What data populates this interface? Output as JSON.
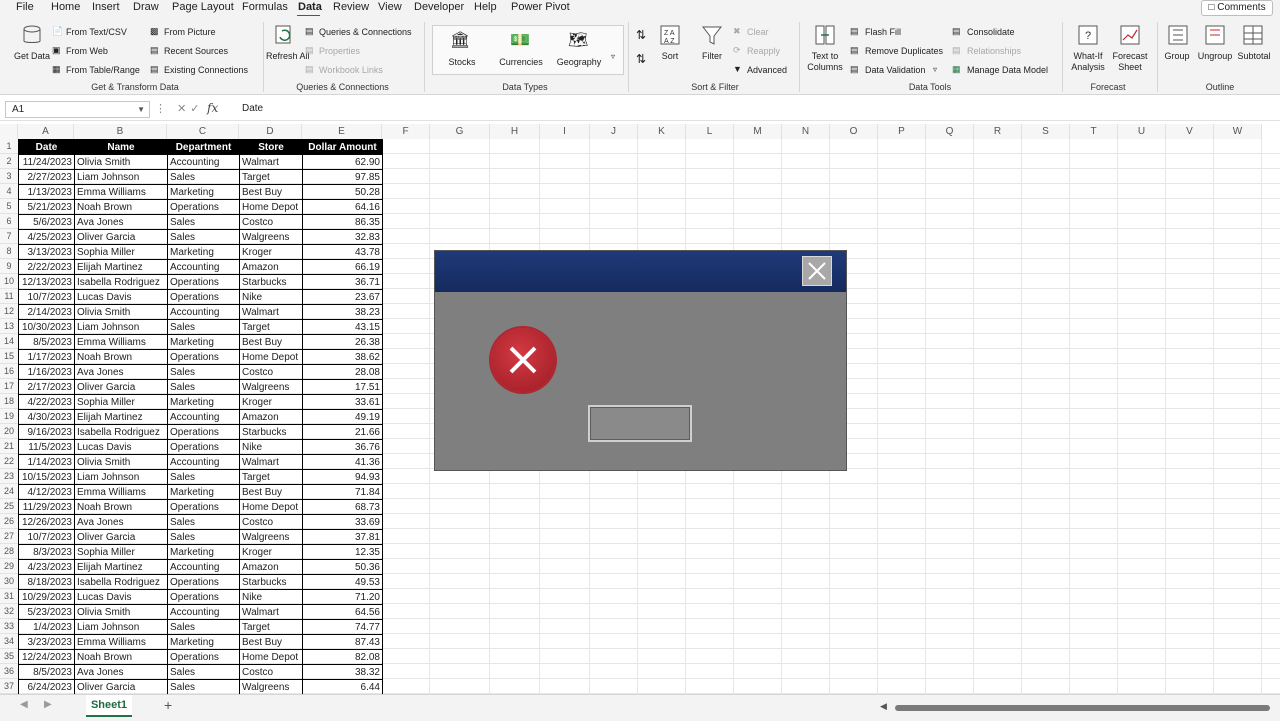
{
  "menu_tabs": [
    "File",
    "Home",
    "Insert",
    "Draw",
    "Page Layout",
    "Formulas",
    "Data",
    "Review",
    "View",
    "Developer",
    "Help",
    "Power Pivot"
  ],
  "active_tab": "Data",
  "comments_label": "Comments",
  "ribbon": {
    "get_data": "Get Data",
    "from_text_csv": "From Text/CSV",
    "from_web": "From Web",
    "from_table_range": "From Table/Range",
    "from_picture": "From Picture",
    "recent_sources": "Recent Sources",
    "existing_connections": "Existing Connections",
    "refresh_all": "Refresh All",
    "queries_connections": "Queries & Connections",
    "properties": "Properties",
    "workbook_links": "Workbook Links",
    "stocks": "Stocks",
    "currencies": "Currencies",
    "geography": "Geography",
    "sort": "Sort",
    "filter": "Filter",
    "clear": "Clear",
    "reapply": "Reapply",
    "advanced": "Advanced",
    "text_to_columns": "Text to Columns",
    "flash_fill": "Flash Fill",
    "remove_duplicates": "Remove Duplicates",
    "data_validation": "Data Validation",
    "consolidate": "Consolidate",
    "relationships": "Relationships",
    "manage_data_model": "Manage Data Model",
    "what_if": "What-If Analysis",
    "forecast_sheet": "Forecast Sheet",
    "group": "Group",
    "ungroup": "Ungroup",
    "subtotal": "Subtotal",
    "groups": {
      "get_transform": "Get & Transform Data",
      "queries": "Queries & Connections",
      "data_types": "Data Types",
      "sort_filter": "Sort & Filter",
      "data_tools": "Data Tools",
      "forecast": "Forecast",
      "outline": "Outline"
    }
  },
  "formula_bar": {
    "cell_ref": "A1",
    "value": "Date"
  },
  "columns": [
    "A",
    "B",
    "C",
    "D",
    "E",
    "F",
    "G",
    "H",
    "I",
    "J",
    "K",
    "L",
    "M",
    "N",
    "O",
    "P",
    "Q",
    "R",
    "S",
    "T",
    "U",
    "V",
    "W"
  ],
  "rows": [
    "1",
    "2",
    "3",
    "4",
    "5",
    "6",
    "7",
    "8",
    "9",
    "10",
    "11",
    "12",
    "13",
    "14",
    "15",
    "16",
    "17",
    "18",
    "19",
    "20",
    "21",
    "22",
    "23",
    "24",
    "25",
    "26",
    "27",
    "28",
    "29",
    "30",
    "31",
    "32",
    "33",
    "34",
    "35",
    "36",
    "37"
  ],
  "table": {
    "headers": [
      "Date",
      "Name",
      "Department",
      "Store",
      "Dollar Amount"
    ],
    "rows": [
      [
        "11/24/2023",
        "Olivia Smith",
        "Accounting",
        "Walmart",
        "62.90"
      ],
      [
        "2/27/2023",
        "Liam Johnson",
        "Sales",
        "Target",
        "97.85"
      ],
      [
        "1/13/2023",
        "Emma Williams",
        "Marketing",
        "Best Buy",
        "50.28"
      ],
      [
        "5/21/2023",
        "Noah Brown",
        "Operations",
        "Home Depot",
        "64.16"
      ],
      [
        "5/6/2023",
        "Ava Jones",
        "Sales",
        "Costco",
        "86.35"
      ],
      [
        "4/25/2023",
        "Oliver Garcia",
        "Sales",
        "Walgreens",
        "32.83"
      ],
      [
        "3/13/2023",
        "Sophia Miller",
        "Marketing",
        "Kroger",
        "43.78"
      ],
      [
        "2/22/2023",
        "Elijah Martinez",
        "Accounting",
        "Amazon",
        "66.19"
      ],
      [
        "12/13/2023",
        "Isabella Rodriguez",
        "Operations",
        "Starbucks",
        "36.71"
      ],
      [
        "10/7/2023",
        "Lucas Davis",
        "Operations",
        "Nike",
        "23.67"
      ],
      [
        "2/14/2023",
        "Olivia Smith",
        "Accounting",
        "Walmart",
        "38.23"
      ],
      [
        "10/30/2023",
        "Liam Johnson",
        "Sales",
        "Target",
        "43.15"
      ],
      [
        "8/5/2023",
        "Emma Williams",
        "Marketing",
        "Best Buy",
        "26.38"
      ],
      [
        "1/17/2023",
        "Noah Brown",
        "Operations",
        "Home Depot",
        "38.62"
      ],
      [
        "1/16/2023",
        "Ava Jones",
        "Sales",
        "Costco",
        "28.08"
      ],
      [
        "2/17/2023",
        "Oliver Garcia",
        "Sales",
        "Walgreens",
        "17.51"
      ],
      [
        "4/22/2023",
        "Sophia Miller",
        "Marketing",
        "Kroger",
        "33.61"
      ],
      [
        "4/30/2023",
        "Elijah Martinez",
        "Accounting",
        "Amazon",
        "49.19"
      ],
      [
        "9/16/2023",
        "Isabella Rodriguez",
        "Operations",
        "Starbucks",
        "21.66"
      ],
      [
        "11/5/2023",
        "Lucas Davis",
        "Operations",
        "Nike",
        "36.76"
      ],
      [
        "1/14/2023",
        "Olivia Smith",
        "Accounting",
        "Walmart",
        "41.36"
      ],
      [
        "10/15/2023",
        "Liam Johnson",
        "Sales",
        "Target",
        "94.93"
      ],
      [
        "4/12/2023",
        "Emma Williams",
        "Marketing",
        "Best Buy",
        "71.84"
      ],
      [
        "11/29/2023",
        "Noah Brown",
        "Operations",
        "Home Depot",
        "68.73"
      ],
      [
        "12/26/2023",
        "Ava Jones",
        "Sales",
        "Costco",
        "33.69"
      ],
      [
        "10/7/2023",
        "Oliver Garcia",
        "Sales",
        "Walgreens",
        "37.81"
      ],
      [
        "8/3/2023",
        "Sophia Miller",
        "Marketing",
        "Kroger",
        "12.35"
      ],
      [
        "4/23/2023",
        "Elijah Martinez",
        "Accounting",
        "Amazon",
        "50.36"
      ],
      [
        "8/18/2023",
        "Isabella Rodriguez",
        "Operations",
        "Starbucks",
        "49.53"
      ],
      [
        "10/29/2023",
        "Lucas Davis",
        "Operations",
        "Nike",
        "71.20"
      ],
      [
        "5/23/2023",
        "Olivia Smith",
        "Accounting",
        "Walmart",
        "64.56"
      ],
      [
        "1/4/2023",
        "Liam Johnson",
        "Sales",
        "Target",
        "74.77"
      ],
      [
        "3/23/2023",
        "Emma Williams",
        "Marketing",
        "Best Buy",
        "87.43"
      ],
      [
        "12/24/2023",
        "Noah Brown",
        "Operations",
        "Home Depot",
        "82.08"
      ],
      [
        "8/5/2023",
        "Ava Jones",
        "Sales",
        "Costco",
        "38.32"
      ],
      [
        "6/24/2023",
        "Oliver Garcia",
        "Sales",
        "Walgreens",
        "6.44"
      ]
    ]
  },
  "sheet_tab": "Sheet1",
  "colors": {
    "accent": "#217346",
    "header_bg": "#000000",
    "dialog_title": "#1f3a7a",
    "error_icon": "#c0262f"
  }
}
